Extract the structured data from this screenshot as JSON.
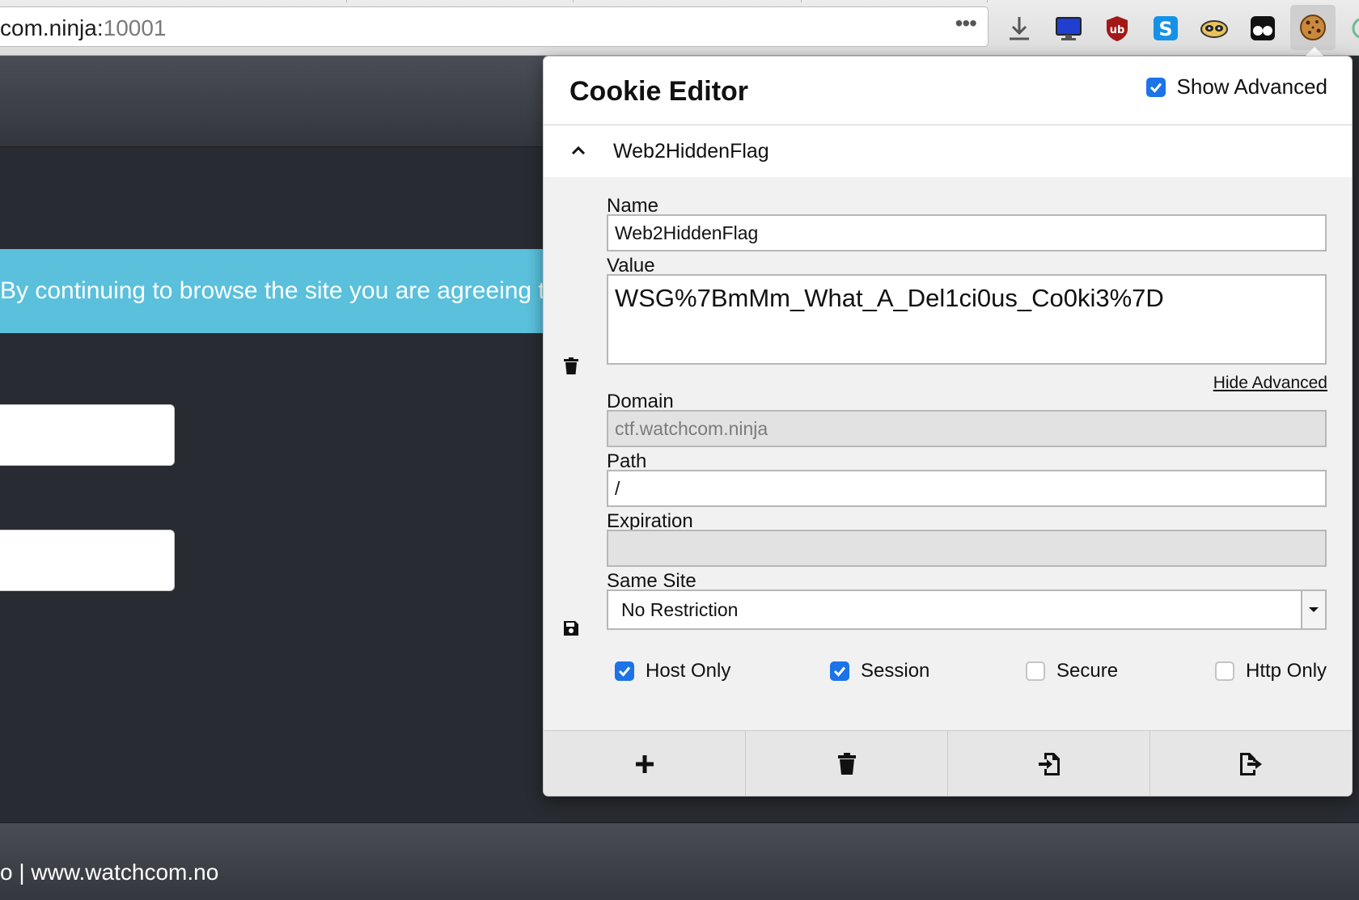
{
  "browser": {
    "url_host": "com.ninja:",
    "url_port": "10001",
    "url_menu": "•••",
    "toolbar_icons": [
      "download-icon",
      "monitor-icon",
      "ublock-icon",
      "skype-icon",
      "raccoon-icon",
      "glasses-icon",
      "cookie-icon"
    ]
  },
  "page": {
    "banner_text": "By continuing to browse the site you are agreeing to o",
    "footer_text": "o | www.watchcom.no",
    "banner_color": "#5ac0dc"
  },
  "popup": {
    "title": "Cookie Editor",
    "show_advanced_label": "Show Advanced",
    "cookie_name_header": "Web2HiddenFlag",
    "name_label": "Name",
    "name_value": "Web2HiddenFlag",
    "value_label": "Value",
    "value_value": "WSG%7BmMm_What_A_Del1ci0us_Co0ki3%7D",
    "hide_advanced_label": "Hide Advanced",
    "domain_label": "Domain",
    "domain_value": "ctf.watchcom.ninja",
    "path_label": "Path",
    "path_value": "/",
    "expiration_label": "Expiration",
    "expiration_value": "",
    "same_site_label": "Same Site",
    "same_site_value": "No Restriction",
    "flags": {
      "host_only": "Host Only",
      "session": "Session",
      "secure": "Secure",
      "http_only": "Http Only"
    },
    "accent_color": "#1d73e8"
  }
}
